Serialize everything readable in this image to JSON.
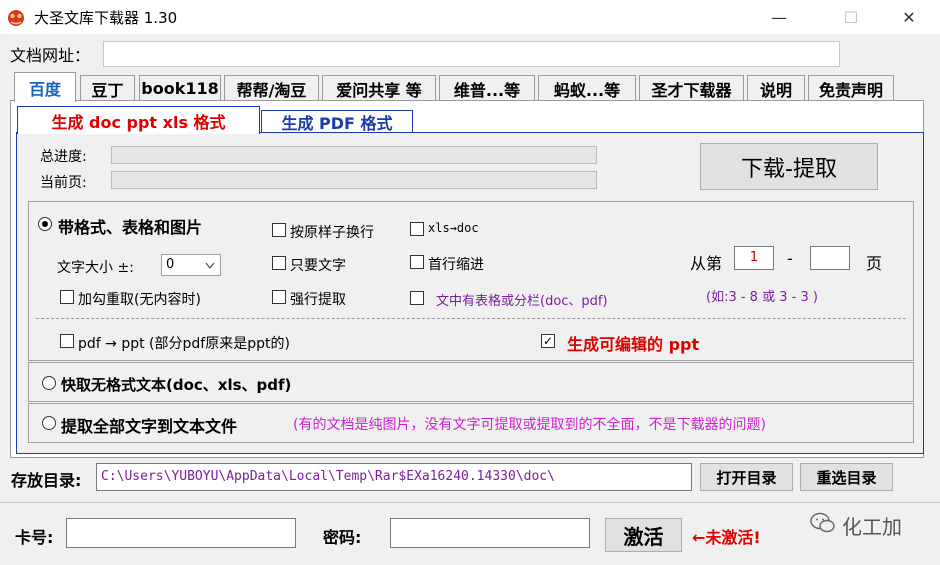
{
  "window": {
    "title": "大圣文库下载器 1.30",
    "minimize": "—",
    "maximize": "☐",
    "close": "✕"
  },
  "url_row": {
    "label": "文档网址：",
    "value": ""
  },
  "tabs": [
    {
      "label": "百度"
    },
    {
      "label": "豆丁"
    },
    {
      "label": "book118"
    },
    {
      "label": "帮帮/淘豆"
    },
    {
      "label": "爱问共享 等"
    },
    {
      "label": "维普...等"
    },
    {
      "label": "蚂蚁...等"
    },
    {
      "label": "圣才下载器"
    },
    {
      "label": "说明"
    },
    {
      "label": "免责声明"
    }
  ],
  "subtabs": [
    {
      "label": "生成 doc ppt xls 格式"
    },
    {
      "label": "生成 PDF 格式"
    }
  ],
  "progress": {
    "total_label": "总进度:",
    "current_label": "当前页:",
    "total_value": 0,
    "current_value": 0
  },
  "download_button": "下载-提取",
  "options": {
    "formatted_radio": "带格式、表格和图片",
    "font_size_label": "文字大小 ±:",
    "font_size_value": "0",
    "add_hook": "加勾重取(无内容时)",
    "original_linebreak": "按原样子换行",
    "text_only": "只要文字",
    "force_extract": "强行提取",
    "xls_doc": "xls→doc",
    "first_indent": "首行缩进",
    "table_columns": "文中有表格或分栏(doc、pdf)",
    "from_label": "从第",
    "from_value": "1",
    "dash": "-",
    "to_value": "",
    "page_label": "页",
    "page_hint": "(如:3 - 8  或 3 - 3 )",
    "pdf_ppt": "pdf → ppt (部分pdf原来是ppt的)",
    "editable_ppt": "生成可编辑的 ppt",
    "quick_text_radio": "快取无格式文本(doc、xls、pdf)",
    "extract_all_radio": "提取全部文字到文本文件",
    "extract_note": "(有的文档是纯图片，没有文字可提取或提取到的不全面，不是下载器的问题)"
  },
  "storage": {
    "label": "存放目录:",
    "path": "C:\\Users\\YUBOYU\\AppData\\Local\\Temp\\Rar$EXa16240.14330\\doc\\",
    "open_button": "打开目录",
    "reselect_button": "重选目录"
  },
  "activation": {
    "card_label": "卡号:",
    "card_value": "",
    "password_label": "密码:",
    "password_value": "",
    "activate_button": "激活",
    "status": "←未激活!"
  },
  "watermark": "化工加",
  "colors": {
    "accent_blue": "#1565c0",
    "red": "#e00000",
    "magenta": "#d020d0",
    "purple": "#7a1fa2"
  }
}
